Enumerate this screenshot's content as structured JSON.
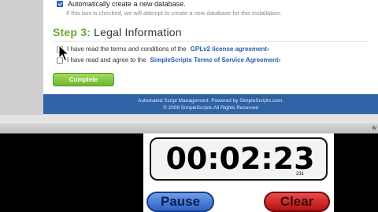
{
  "install_form": {
    "auto_create_label": "Automatically create a new database.",
    "auto_create_note": "If this box is checked, we will attempt to create a new database for this installation.",
    "step_number": "Step 3:",
    "step_title": "Legal Information",
    "terms_prefix": "I have read the terms and conditions of the",
    "terms_link": "GPLv2 license agreement",
    "tos_prefix": "I have read and agree to the",
    "tos_link": "SimpleScripts Terms of Service Agreement",
    "link_arrow": "›",
    "complete_button": "Complete",
    "footer_line1": "Automated Script Management. Powered by SimpleScripts.com.",
    "footer_line2": "© 2009 SimpleScripts All Rights Reserved"
  },
  "browser": {
    "status_char": "w"
  },
  "stopwatch": {
    "time": "00:02:23",
    "hundredths": "231",
    "pause_button": "Pause",
    "clear_button": "Clear"
  }
}
